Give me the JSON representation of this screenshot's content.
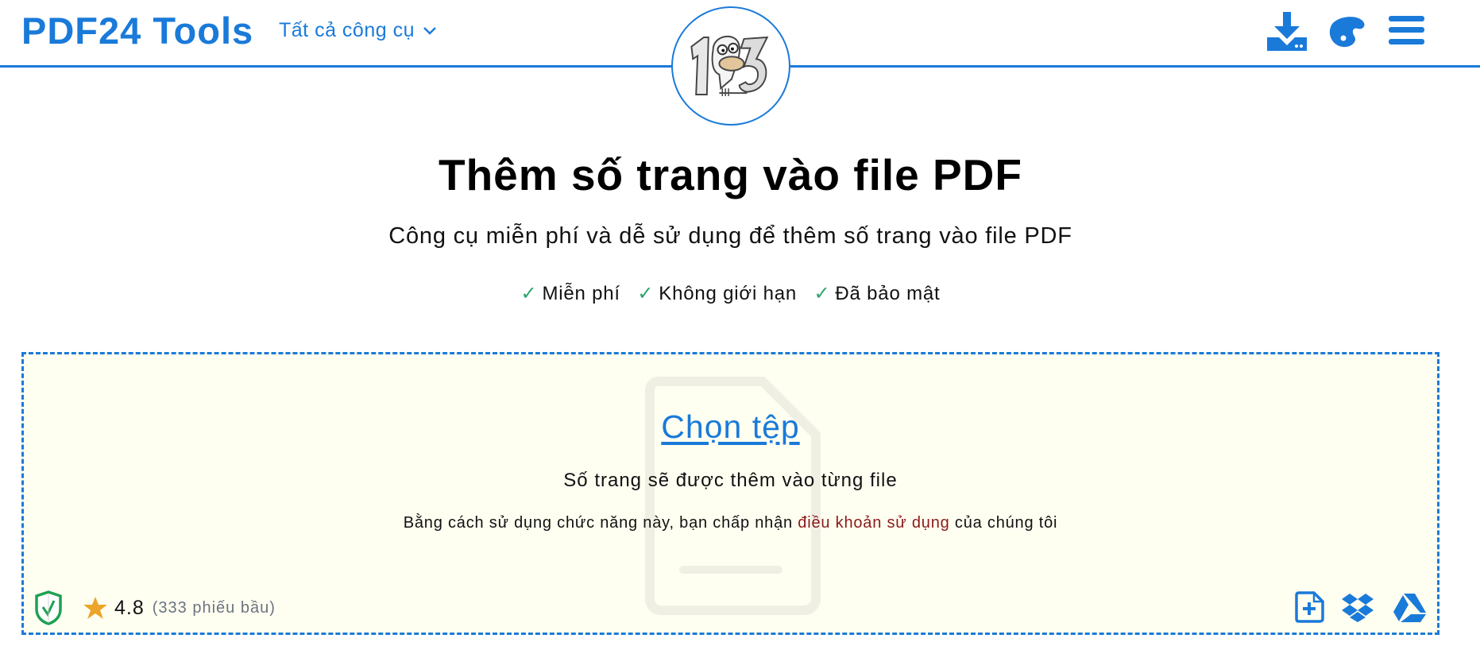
{
  "header": {
    "brand": "PDF24 Tools",
    "tools_menu_label": "Tất cả công cụ",
    "icons": [
      "download-icon",
      "palette-icon",
      "hamburger-menu-icon"
    ],
    "accent_color": "#1a7ad9"
  },
  "tool_logo": {
    "alt": "123",
    "icon": "page-numbers-mascot-logo"
  },
  "main": {
    "title": "Thêm số trang vào file PDF",
    "subtitle": "Công cụ miễn phí và dễ sử dụng để thêm số trang vào file PDF",
    "features": [
      {
        "check": "✓",
        "label": "Miễn phí"
      },
      {
        "check": "✓",
        "label": "Không giới hạn"
      },
      {
        "check": "✓",
        "label": "Đã bảo mật"
      }
    ],
    "check_color": "#2fa36b"
  },
  "dropzone": {
    "choose_label": "Chọn tệp",
    "note": "Số trang sẽ được thêm vào từng file",
    "terms_prefix": "Bằng cách sử dụng chức năng này, bạn chấp nhận",
    "terms_link": "điều khoản sử dụng",
    "terms_suffix": "của chúng tôi",
    "rating_value": "4.8",
    "rating_votes": "(333 phiếu bầu)",
    "source_icons": [
      "new-file-icon",
      "dropbox-icon",
      "google-drive-icon"
    ],
    "background_color": "#fffff1",
    "border_color": "#1a7ad9",
    "link_color": "#8b1a1a"
  }
}
